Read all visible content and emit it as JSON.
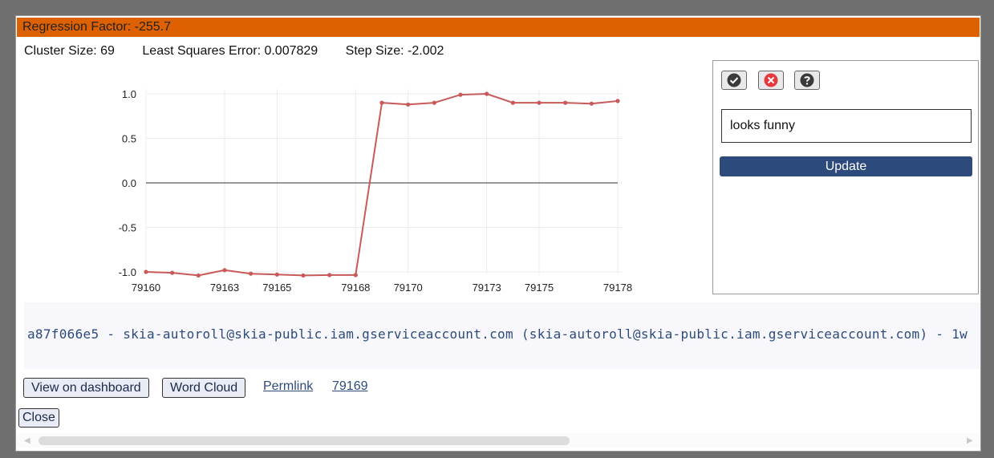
{
  "title": "Regression Factor: -255.7",
  "stats": {
    "cluster_size": "Cluster Size: 69",
    "least_squares": "Least Squares Error: 0.007829",
    "step_size": "Step Size: -2.002"
  },
  "chart_data": {
    "type": "line",
    "x": [
      79160,
      79161,
      79162,
      79163,
      79164,
      79165,
      79166,
      79167,
      79168,
      79169,
      79170,
      79171,
      79172,
      79173,
      79174,
      79175,
      79176,
      79177,
      79178
    ],
    "series": [
      {
        "values": [
          -1.0,
          -1.01,
          -1.04,
          -0.98,
          -1.02,
          -1.03,
          -1.04,
          -1.035,
          -1.035,
          0.9,
          0.88,
          0.9,
          0.99,
          1.0,
          0.9,
          0.9,
          0.9,
          0.89,
          0.92
        ]
      }
    ],
    "xticks": [
      79160,
      79163,
      79165,
      79168,
      79170,
      79173,
      79175,
      79178
    ],
    "yticks": [
      "1.0",
      "0.5",
      "0.0",
      "-0.5",
      "-1.0"
    ],
    "ylim": [
      -1.0,
      1.0
    ],
    "xlim": [
      79160,
      79178
    ],
    "grid": true,
    "line_color": "#c95a5a"
  },
  "panel": {
    "note_value": "looks funny",
    "update_label": "Update",
    "icons": [
      "check-circle-icon",
      "close-circle-icon",
      "help-icon"
    ]
  },
  "commit": {
    "text": "a87f066e5 - skia-autoroll@skia-public.iam.gserviceaccount.com (skia-autoroll@skia-public.iam.gserviceaccount.com) - 1w"
  },
  "actions": {
    "dashboard": "View on dashboard",
    "word_cloud": "Word Cloud",
    "permalink": "Permlink",
    "commit_link": "79169",
    "close": "Close"
  }
}
